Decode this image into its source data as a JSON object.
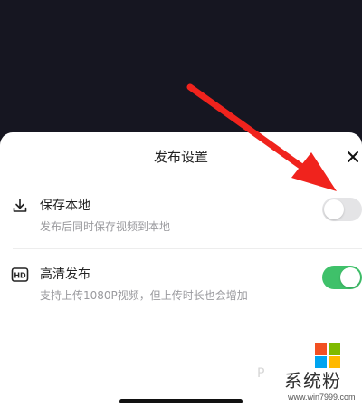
{
  "sheet": {
    "title": "发布设置",
    "close_symbol": "×"
  },
  "settings": [
    {
      "icon": "download-icon",
      "title": "保存本地",
      "subtitle": "发布后同时保存视频到本地",
      "enabled": false
    },
    {
      "icon": "hd-icon",
      "title": "高清发布",
      "subtitle": "支持上传1080P视频，但上传时长也会增加",
      "enabled": true
    }
  ],
  "hd_icon_text": "HD",
  "watermark": {
    "text": "系统粉",
    "url": "www.win7999.com",
    "p_mark": "P",
    "colors": [
      "#f25022",
      "#7fba00",
      "#00a4ef",
      "#ffb900"
    ]
  },
  "colors": {
    "toggle_on": "#3fc16a",
    "toggle_off": "#e4e4e6",
    "arrow": "#f0231d"
  }
}
